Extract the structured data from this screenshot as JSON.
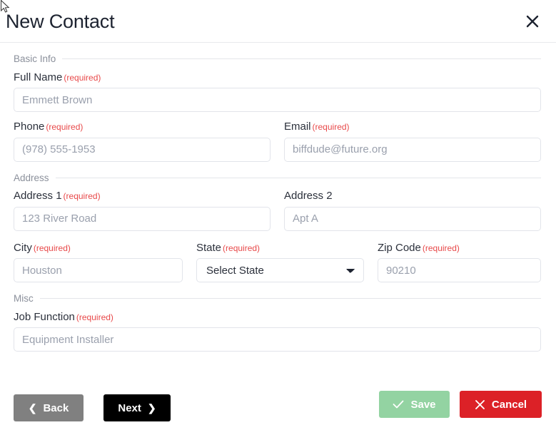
{
  "header": {
    "title": "New Contact",
    "close_icon": "close-icon"
  },
  "sections": {
    "basic_info": "Basic Info",
    "address": "Address",
    "misc": "Misc"
  },
  "required_tag": "(required)",
  "fields": {
    "full_name": {
      "label": "Full Name",
      "placeholder": "Emmett Brown",
      "required": true
    },
    "phone": {
      "label": "Phone",
      "placeholder": "(978) 555-1953",
      "required": true
    },
    "email": {
      "label": "Email",
      "placeholder": "biffdude@future.org",
      "required": true
    },
    "address1": {
      "label": "Address 1",
      "placeholder": "123 River Road",
      "required": true
    },
    "address2": {
      "label": "Address 2",
      "placeholder": "Apt A",
      "required": false
    },
    "city": {
      "label": "City",
      "placeholder": "Houston",
      "required": true
    },
    "state": {
      "label": "State",
      "value": "Select State",
      "required": true,
      "options": [
        "Select State"
      ]
    },
    "zip": {
      "label": "Zip Code",
      "placeholder": "90210",
      "required": true
    },
    "job_function": {
      "label": "Job Function",
      "placeholder": "Equipment Installer",
      "required": true
    }
  },
  "buttons": {
    "back": {
      "label": "Back",
      "icon": "chevron-left-icon"
    },
    "next": {
      "label": "Next",
      "icon": "chevron-right-icon"
    },
    "save": {
      "label": "Save",
      "icon": "check-icon"
    },
    "cancel": {
      "label": "Cancel",
      "icon": "x-icon"
    }
  },
  "colors": {
    "back": "#808080",
    "next": "#000000",
    "save": "#93d3a2",
    "cancel": "#dc2127",
    "required": "#e8494a"
  }
}
